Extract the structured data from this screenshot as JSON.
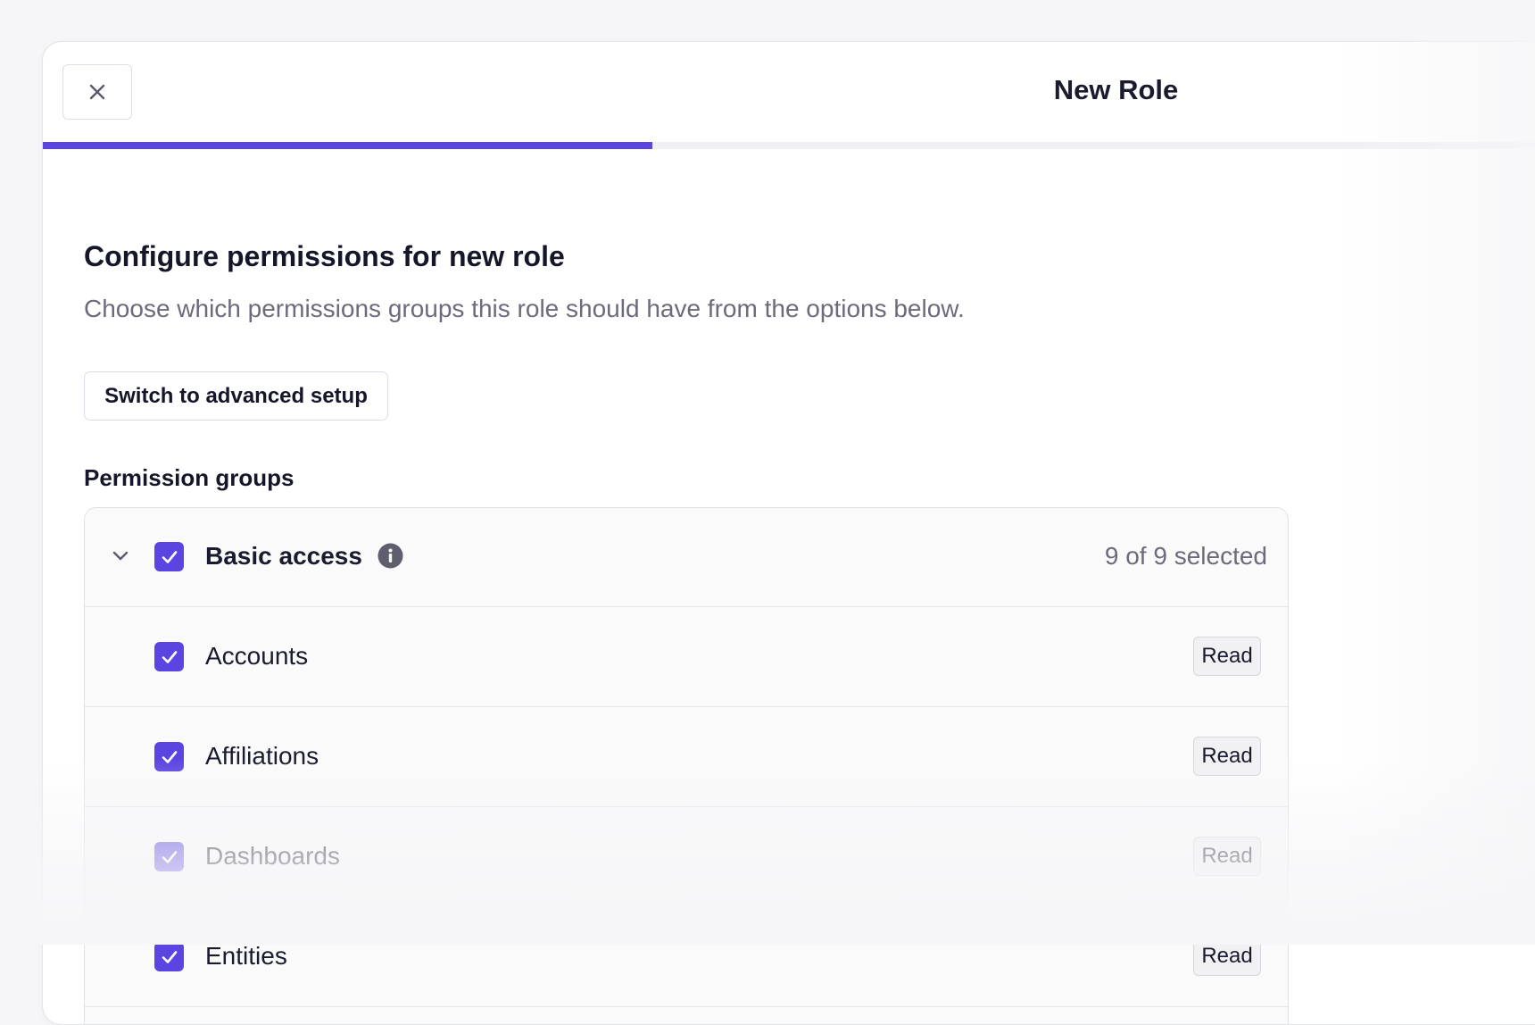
{
  "header": {
    "title": "New Role",
    "close_icon": "close-icon",
    "progress_percent": 40.2
  },
  "content": {
    "title": "Configure permissions for new role",
    "subtitle": "Choose which permissions groups this role should have from the options below.",
    "advanced_button_label": "Switch to advanced setup",
    "section_label": "Permission groups"
  },
  "permission_groups": {
    "group": {
      "label": "Basic access",
      "checked": true,
      "expanded": true,
      "count_text": "9 of 9 selected",
      "info_icon": "info-icon",
      "chevron_icon": "chevron-down-icon"
    },
    "items": [
      {
        "label": "Accounts",
        "checked": true,
        "access": "Read"
      },
      {
        "label": "Affiliations",
        "checked": true,
        "access": "Read"
      },
      {
        "label": "Dashboards",
        "checked": true,
        "access": "Read"
      },
      {
        "label": "Entities",
        "checked": true,
        "access": "Read"
      }
    ]
  },
  "colors": {
    "accent": "#5b45e0",
    "background": "#f6f6f8",
    "text_primary": "#1b1b2f",
    "text_secondary": "#6b6b7c"
  }
}
